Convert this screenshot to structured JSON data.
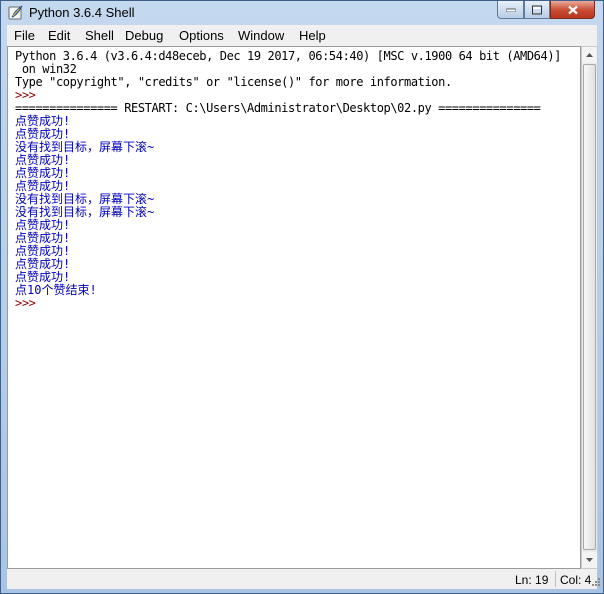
{
  "window": {
    "title": "Python 3.6.4 Shell"
  },
  "menu": [
    "File",
    "Edit",
    "Shell",
    "Debug",
    "Options",
    "Window",
    "Help"
  ],
  "shell": {
    "lines": [
      {
        "text": "Python 3.6.4 (v3.6.4:d48eceb, Dec 19 2017, 06:54:40) [MSC v.1900 64 bit (AMD64)]",
        "kind": "text"
      },
      {
        "text": " on win32",
        "kind": "text"
      },
      {
        "text": "Type \"copyright\", \"credits\" or \"license()\" for more information.",
        "kind": "text"
      },
      {
        "text": ">>> ",
        "kind": "prompt"
      },
      {
        "text": "=============== RESTART: C:\\Users\\Administrator\\Desktop\\02.py ===============",
        "kind": "text"
      },
      {
        "text": "点赞成功!",
        "kind": "out"
      },
      {
        "text": "点赞成功!",
        "kind": "out"
      },
      {
        "text": "没有找到目标，屏幕下滚~",
        "kind": "out"
      },
      {
        "text": "点赞成功!",
        "kind": "out"
      },
      {
        "text": "点赞成功!",
        "kind": "out"
      },
      {
        "text": "点赞成功!",
        "kind": "out"
      },
      {
        "text": "没有找到目标，屏幕下滚~",
        "kind": "out"
      },
      {
        "text": "没有找到目标，屏幕下滚~",
        "kind": "out"
      },
      {
        "text": "点赞成功!",
        "kind": "out"
      },
      {
        "text": "点赞成功!",
        "kind": "out"
      },
      {
        "text": "点赞成功!",
        "kind": "out"
      },
      {
        "text": "点赞成功!",
        "kind": "out"
      },
      {
        "text": "点赞成功!",
        "kind": "out"
      },
      {
        "text": "点10个赞结束!",
        "kind": "out"
      },
      {
        "text": ">>> ",
        "kind": "prompt"
      }
    ]
  },
  "status": {
    "ln": "Ln: 19",
    "col": "Col: 4"
  }
}
